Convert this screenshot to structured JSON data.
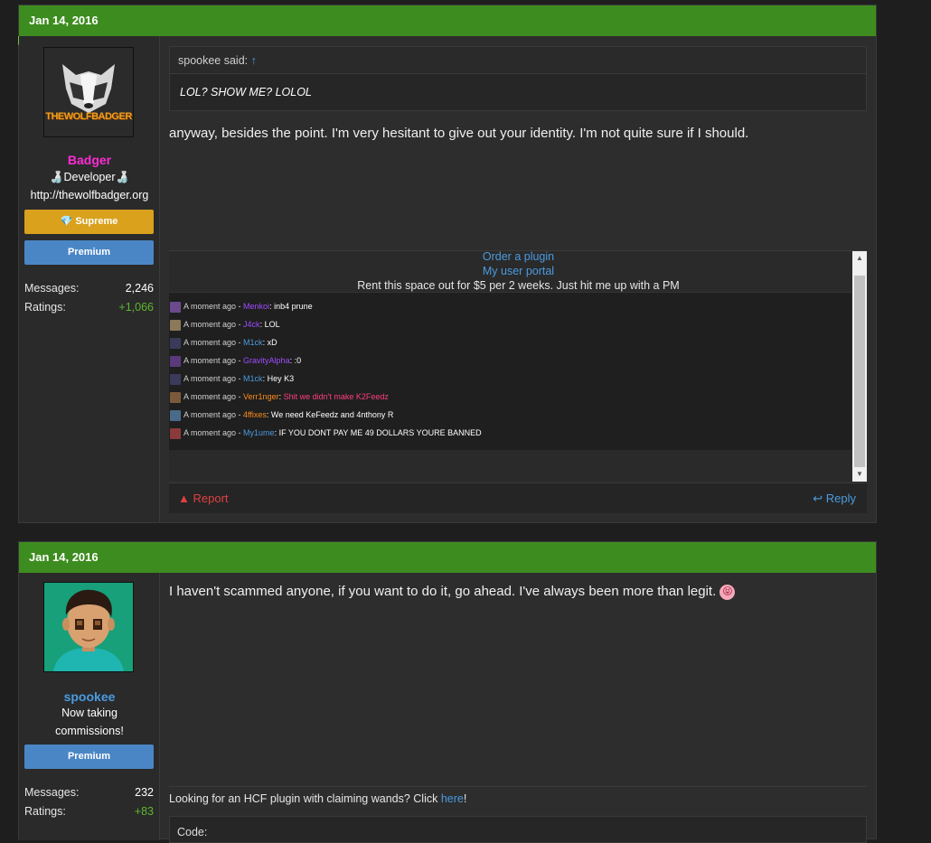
{
  "posts": [
    {
      "date": "Jan 14, 2016",
      "user": {
        "name": "Badger",
        "name_color": "#ff2bd6",
        "title_line1": "Developer",
        "title_line2": "http://thewolfbadger.org",
        "avatar_text": "THEWOLFBADGER",
        "badges": [
          {
            "label": "Supreme",
            "color": "#d9a11c",
            "icon": "diamond-icon"
          },
          {
            "label": "Premium",
            "color": "#4a86c5"
          }
        ],
        "stats": [
          {
            "label": "Messages:",
            "value": "2,246"
          },
          {
            "label": "Ratings:",
            "value": "+1,066"
          }
        ]
      },
      "quote": {
        "author": "spookee said:",
        "arrow": "↑",
        "text": "LOL? SHOW ME? LOLOL"
      },
      "message": "anyway, besides the point. I'm very hesitant to give out your identity. I'm not quite sure if I should.",
      "signature": {
        "link1": "Order a plugin",
        "link2": "My user portal",
        "rent_text": "Rent this space out for $5 per 2 weeks. Just hit me up with a PM"
      },
      "chat": [
        {
          "time": "A moment ago",
          "user": "Menkoi",
          "user_color": "#a04bff",
          "text": "inb4 prune",
          "text_color": "#ffffff",
          "ava": "#6a4a8c"
        },
        {
          "time": "A moment ago",
          "user": "J4ck",
          "user_color": "#a04bff",
          "text": "LOL",
          "text_color": "#ffffff",
          "ava": "#8a7a5a"
        },
        {
          "time": "A moment ago",
          "user": "M1ck",
          "user_color": "#4a9be0",
          "text": "xD",
          "text_color": "#ffffff",
          "ava": "#3a3a5a"
        },
        {
          "time": "A moment ago",
          "user": "GravityAlpha",
          "user_color": "#a04bff",
          "text": ":0",
          "text_color": "#ffffff",
          "ava": "#5a3a7a"
        },
        {
          "time": "A moment ago",
          "user": "M1ck",
          "user_color": "#4a9be0",
          "text": "Hey K3",
          "text_color": "#ffffff",
          "ava": "#3a3a5a"
        },
        {
          "time": "A moment ago",
          "user": "Verr1nger",
          "user_color": "#ff8c1a",
          "text": "Shit we didn't make K2Feedz",
          "text_color": "#ff3d7f",
          "ava": "#7a5a3a"
        },
        {
          "time": "A moment ago",
          "user": "4ffixes",
          "user_color": "#ff8c1a",
          "text": "We need KeFeedz and 4nthony R",
          "text_color": "#ffffff",
          "ava": "#4a6a8a"
        },
        {
          "time": "A moment ago",
          "user": "My1ume",
          "user_color": "#4a9be0",
          "text": "IF YOU DONT PAY ME 49 DOLLARS YOURE BANNED",
          "text_color": "#ffffff",
          "ava": "#8a3a3a"
        }
      ],
      "actions": {
        "report": "Report",
        "reply": "Reply"
      }
    },
    {
      "date": "Jan 14, 2016",
      "user": {
        "name": "spookee",
        "name_color": "#4a9be0",
        "title_line1": "Now taking",
        "title_line2": "commissions!",
        "badges": [
          {
            "label": "Premium",
            "color": "#4a86c5"
          }
        ],
        "stats": [
          {
            "label": "Messages:",
            "value": "232"
          },
          {
            "label": "Ratings:",
            "value": "+83"
          }
        ]
      },
      "message": "I haven't scammed anyone, if you want to do it, go ahead. I've always been more than legit.",
      "signature": {
        "text_before": "Looking for an HCF plugin with claiming wands? Click",
        "link": "here",
        "text_after": "!",
        "code_label": "Code:"
      }
    }
  ],
  "colors": {
    "header": "#3d8c1f",
    "ratings": "#5cb82e",
    "link": "#4a9be0"
  }
}
